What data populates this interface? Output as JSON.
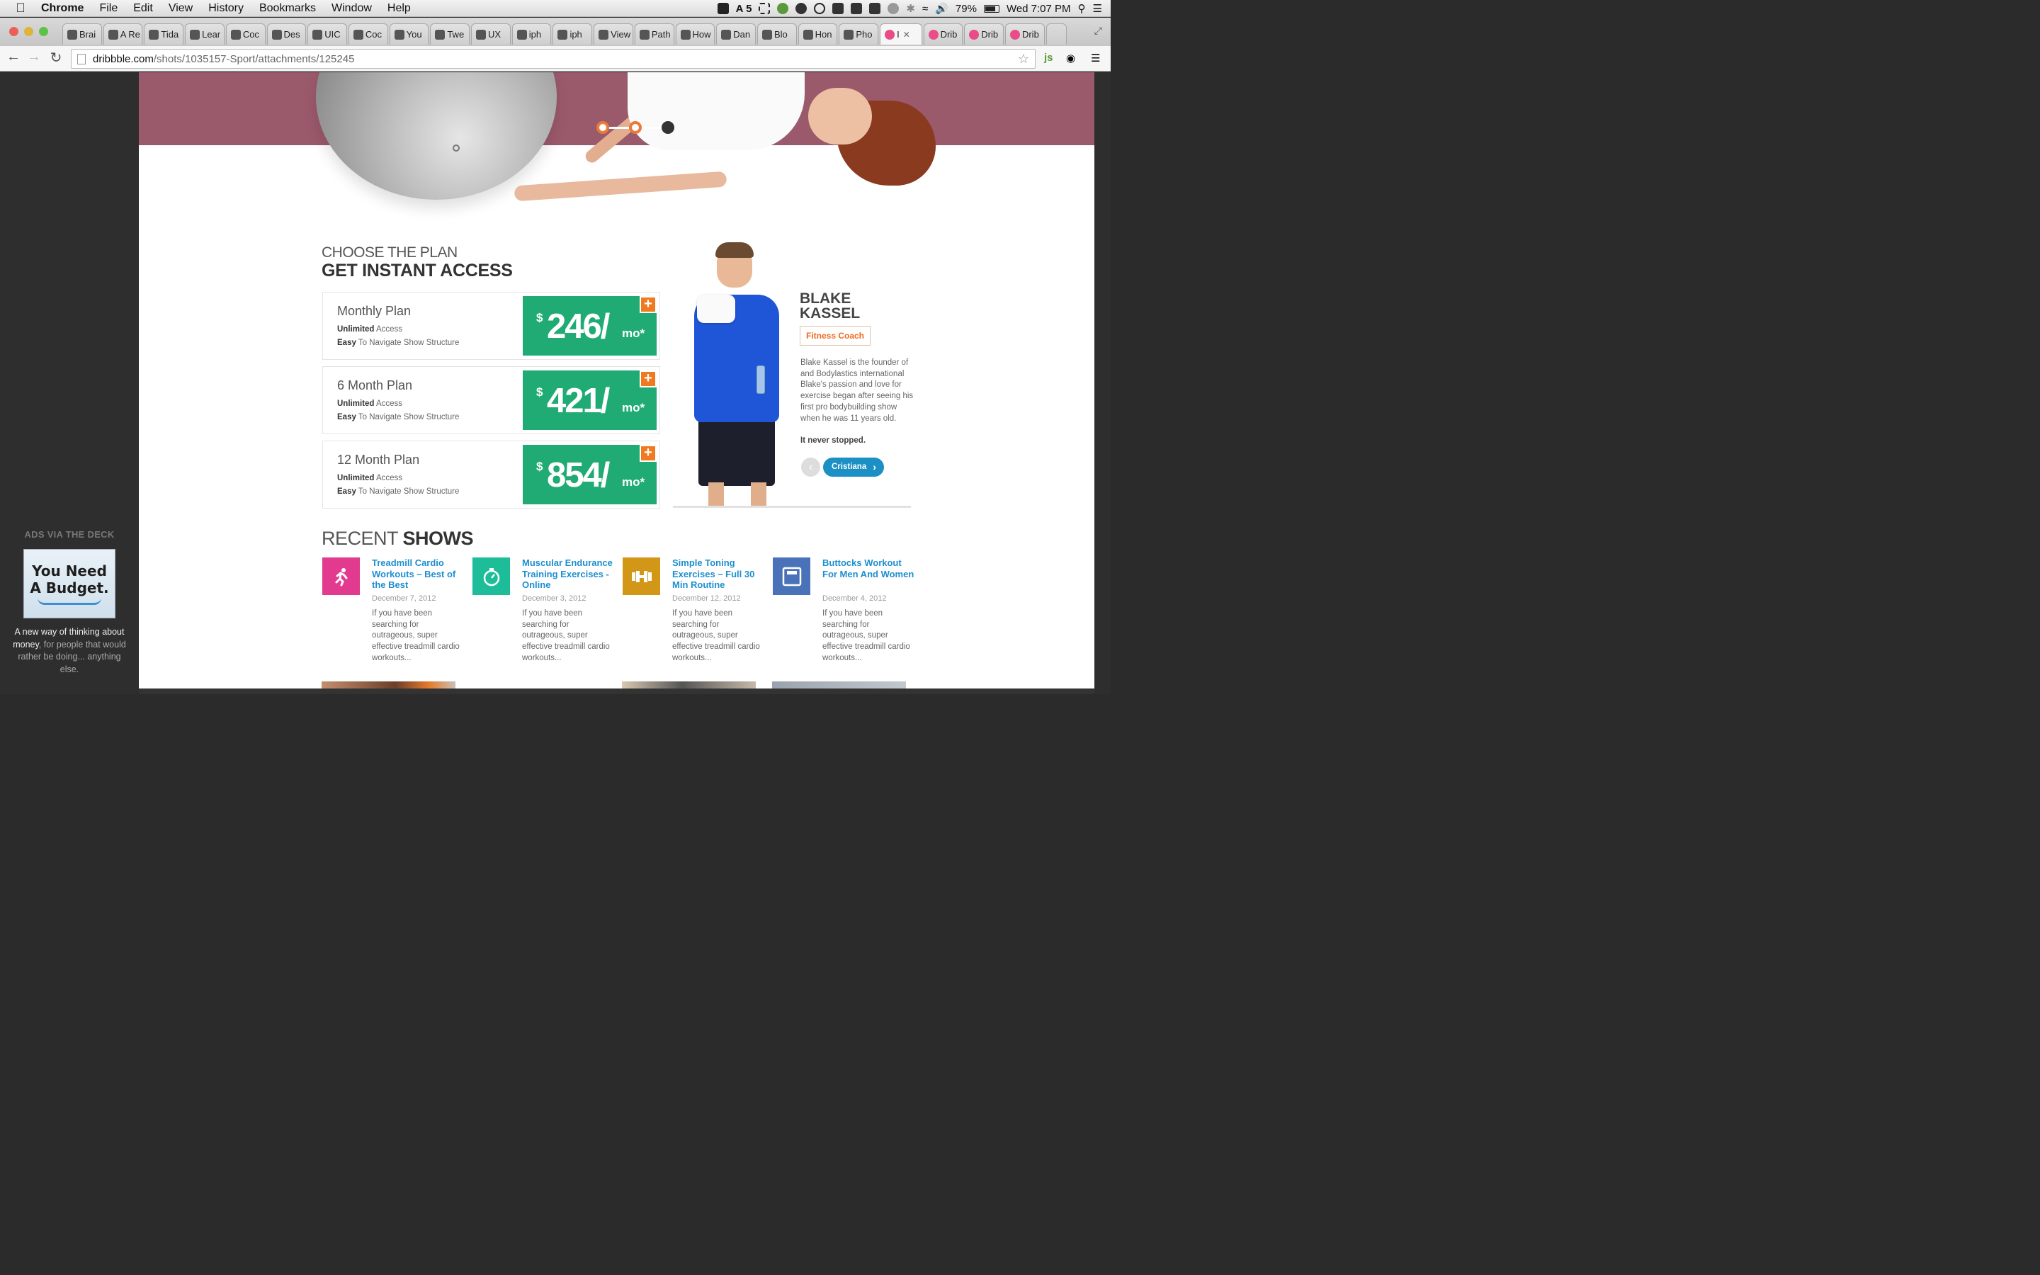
{
  "os_menubar": {
    "app_name": "Chrome",
    "menus": [
      "File",
      "Edit",
      "View",
      "History",
      "Bookmarks",
      "Window",
      "Help"
    ],
    "battery": "79%",
    "clock": "Wed 7:07 PM",
    "notification_count": "5"
  },
  "browser": {
    "tabs": [
      {
        "label": "Brai",
        "icon": "github-icon"
      },
      {
        "label": "A Re",
        "icon": "medium-icon"
      },
      {
        "label": "Tida",
        "icon": "tidal-icon"
      },
      {
        "label": "Lear",
        "icon": "learn-icon"
      },
      {
        "label": "Coc",
        "icon": "cocoa-icon"
      },
      {
        "label": "Des",
        "icon": "design-icon"
      },
      {
        "label": "UIC",
        "icon": "apple-icon"
      },
      {
        "label": "Coc",
        "icon": "apple-icon"
      },
      {
        "label": "You",
        "icon": "a-icon"
      },
      {
        "label": "Twe",
        "icon": "tweet-icon"
      },
      {
        "label": "UX",
        "icon": "ux-icon"
      },
      {
        "label": "iph",
        "icon": "iphone-icon"
      },
      {
        "label": "iph",
        "icon": "stack-icon"
      },
      {
        "label": "View",
        "icon": "apple-icon"
      },
      {
        "label": "Path",
        "icon": "path-icon"
      },
      {
        "label": "How",
        "icon": "quote-icon"
      },
      {
        "label": "Dan",
        "icon": "vimeo-icon"
      },
      {
        "label": "Blo",
        "icon": "tools-icon"
      },
      {
        "label": "Hon",
        "icon": "bc-icon"
      },
      {
        "label": "Pho",
        "icon": "dots-icon"
      },
      {
        "label": "I",
        "icon": "dribbble-icon",
        "active": true
      },
      {
        "label": "Drib",
        "icon": "dribbble-icon"
      },
      {
        "label": "Drib",
        "icon": "dribbble-icon"
      },
      {
        "label": "Drib",
        "icon": "dribbble-icon"
      }
    ],
    "url_host": "dribbble.com",
    "url_path": "/shots/1035157-Sport/attachments/125245",
    "ext_label": "js"
  },
  "ad": {
    "heading": "ADS VIA THE DECK",
    "image_line1": "You Need",
    "image_line2": "A Budget.",
    "copy_a": "A new way of thinking about money",
    "copy_b": ", for people that would rather be doing... anything else."
  },
  "plans_section": {
    "eyebrow": "CHOOSE THE PLAN",
    "title": "GET INSTANT ACCESS",
    "feature_1_bold": "Unlimited",
    "feature_1_rest": " Access",
    "feature_2_bold": "Easy",
    "feature_2_rest": " To Navigate Show Structure",
    "plans": [
      {
        "name": "Monthly Plan",
        "currency": "$",
        "amount": "246/",
        "unit": "mo*"
      },
      {
        "name": "6 Month Plan",
        "currency": "$",
        "amount": "421/",
        "unit": "mo*"
      },
      {
        "name": "12 Month Plan",
        "currency": "$",
        "amount": "854/",
        "unit": "mo*"
      }
    ],
    "add_symbol": "+"
  },
  "coach": {
    "first_name": "BLAKE",
    "last_name": "KASSEL",
    "role": "Fitness Coach",
    "bio": "Blake Kassel is the founder of and Bodylastics international Blake's passion and love for exercise began after seeing his first pro bodybuilding show when he was 11 years old.",
    "tagline": "It never stopped.",
    "next_label": "Cristiana"
  },
  "recent_shows": {
    "heading_light": "RECENT",
    "heading_bold": "SHOWS",
    "items": [
      {
        "title": "Treadmill Cardio Workouts – Best of the Best",
        "date": "December 7, 2012",
        "excerpt": "If you have been searching for outrageous, super effective treadmill cardio workouts...",
        "icon": "running-icon",
        "color": "#e23a8f"
      },
      {
        "title": "Muscular Endurance Training Exercises - Online",
        "date": "December 3, 2012",
        "excerpt": "If you have been searching for outrageous, super effective treadmill cardio workouts...",
        "icon": "stopwatch-icon",
        "color": "#1dbd9a"
      },
      {
        "title": "Simple Toning Exercises – Full 30 Min Routine",
        "date": "December 12, 2012",
        "excerpt": "If you have been searching for outrageous, super effective treadmill cardio workouts...",
        "icon": "dumbbell-icon",
        "color": "#d39717"
      },
      {
        "title": "Buttocks Workout For Men And Women",
        "date": "December 4, 2012",
        "excerpt": "If you have been searching for outrageous, super effective treadmill cardio workouts...",
        "icon": "scale-icon",
        "color": "#4a72b8"
      }
    ]
  },
  "colors": {
    "hero_band": "#9b5a6c",
    "price_green": "#21ab74",
    "accent_orange": "#f07a1f",
    "link_blue": "#1d8fcf"
  }
}
